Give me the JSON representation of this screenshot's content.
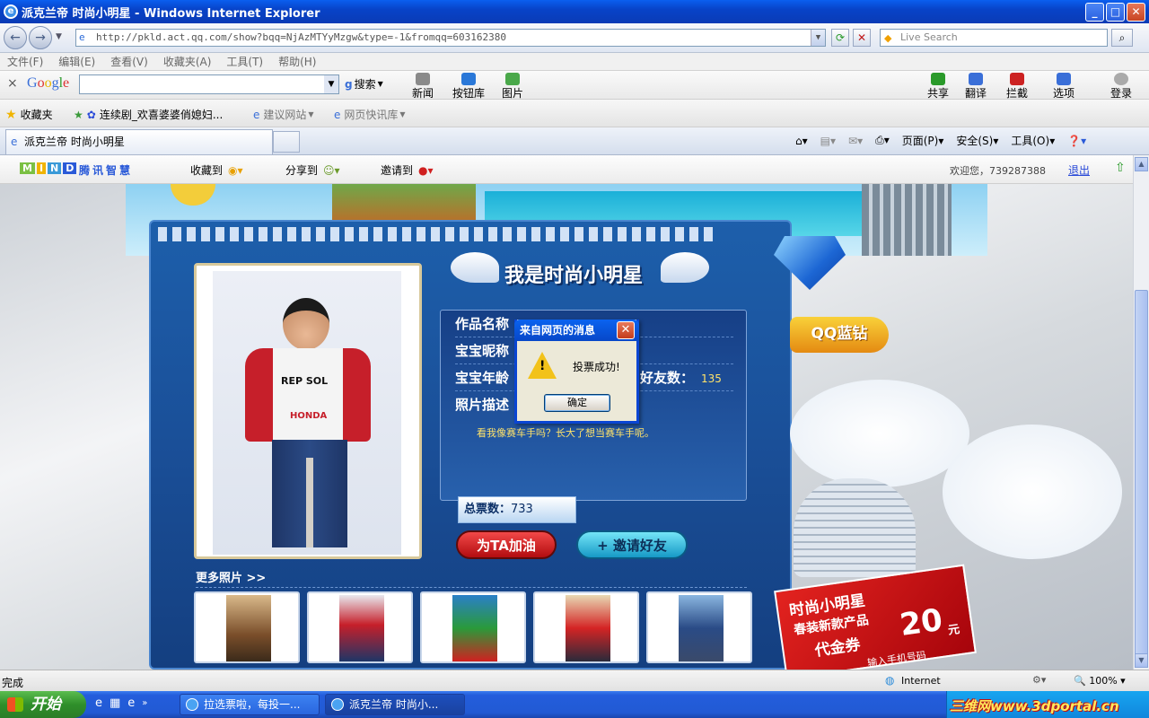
{
  "window": {
    "title": "派克兰帝 时尚小明星 - Windows Internet Explorer"
  },
  "address": {
    "url": "http://pkld.act.qq.com/show?bqq=NjAzMTYyMzgw&type=-1&fromqq=603162380",
    "search_placeholder": "Live Search"
  },
  "menu": [
    "文件(F)",
    "编辑(E)",
    "查看(V)",
    "收藏夹(A)",
    "工具(T)",
    "帮助(H)"
  ],
  "google_toolbar": {
    "logo": "Google",
    "search_label": "搜索",
    "news": "新闻",
    "buttons_lib": "按钮库",
    "images": "图片",
    "share": "共享",
    "translate": "翻译",
    "block": "拦截",
    "options": "选项",
    "login": "登录"
  },
  "favorites": {
    "label": "收藏夹",
    "items": [
      "连续剧_欢喜婆婆俏媳妇...",
      "建议网站",
      "网页快讯库"
    ]
  },
  "tabs": {
    "active": "派克兰帝 时尚小明星"
  },
  "command_bar": {
    "page": "页面(P)",
    "safety": "安全(S)",
    "tools": "工具(O)"
  },
  "mind_bar": {
    "logo": "MIND",
    "brand": "腾讯智慧",
    "collect": "收藏到",
    "share": "分享到",
    "invite": "邀请到",
    "welcome": "欢迎您，739287388",
    "logout": "退出"
  },
  "content": {
    "banner_title": "我是时尚小明星",
    "fields": [
      {
        "label": "作品名称",
        "value": ""
      },
      {
        "label": "宝宝昵称",
        "value": ""
      },
      {
        "label": "宝宝年龄",
        "value": ""
      },
      {
        "label": "照片描述",
        "value": ""
      }
    ],
    "friends_label": "好友数：",
    "friends_count": "135",
    "description": "看我像赛车手吗？长大了想当赛车手呢。",
    "total_votes_label": "总票数：",
    "total_votes": "733",
    "cheer_button": "为TA加油",
    "invite_button": "+ 邀请好友",
    "more_photos": "更多照片 >>",
    "jacket_text": "REP SOL",
    "jacket_brand": "HONDA"
  },
  "side": {
    "qq_diamond": "QQ蓝钻",
    "promo_line1": "时尚小明星",
    "promo_line2": "春装新款产品",
    "promo_line3": "代金券",
    "promo_amount": "20",
    "promo_unit": "元",
    "promo_sub": "输入手机号码"
  },
  "dialog": {
    "title": "来自网页的消息",
    "message": "投票成功!",
    "ok": "确定"
  },
  "status": {
    "text": "完成",
    "zone": "Internet",
    "zoom": "100%"
  },
  "taskbar": {
    "start": "开始",
    "tasks": [
      "拉选票啦，每投一...",
      "派克兰帝 时尚小..."
    ],
    "watermark": "三维网www.3dportal.cn"
  },
  "colors": {
    "title_blue": "#0a5ff0",
    "panel_blue": "#1d5fab",
    "vote_yellow": "#ffe36a",
    "cheer_red": "#e32626"
  }
}
